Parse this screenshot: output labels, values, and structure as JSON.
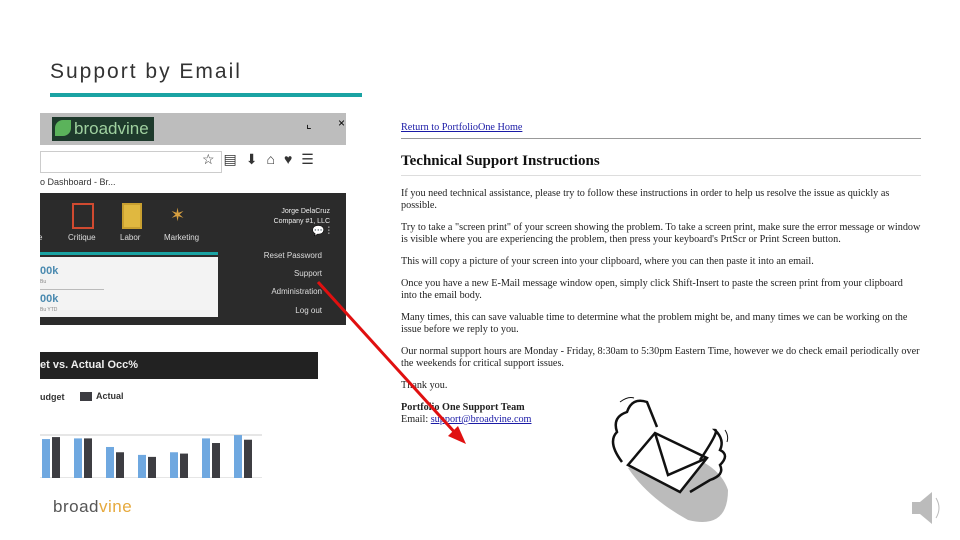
{
  "slide": {
    "title": "Support by Email",
    "logo": "broadvine",
    "logo_accent": "vine"
  },
  "screenshot": {
    "app_logo": "broadvine",
    "breadcrumb": "o Dashboard - Br...",
    "nav_items": [
      "e",
      "Critique",
      "Labor",
      "Marketing"
    ],
    "user_name": "Jorge DelaCruz",
    "company": "Company #1, LLC",
    "cards": [
      {
        "value": "00k",
        "label": "Bu"
      },
      {
        "value": "00k",
        "label": "Bu YTD"
      }
    ],
    "menu": [
      "Reset Password",
      "Support",
      "Administration",
      "Log out"
    ],
    "chart": {
      "title": "et vs. Actual Occ%",
      "legend": [
        {
          "name": "udget",
          "color": "#6fa8e0"
        },
        {
          "name": "Actual",
          "color": "#3d3d42"
        }
      ],
      "budget": [
        0.59,
        0.6,
        0.47,
        0.35,
        0.39,
        0.6,
        0.65
      ],
      "actual": [
        0.62,
        0.6,
        0.39,
        0.32,
        0.37,
        0.53,
        0.58
      ]
    }
  },
  "doc": {
    "return_link": "Return to PortfolioOne Home",
    "heading": "Technical Support Instructions",
    "paragraphs": [
      "If you need technical assistance, please try to follow these instructions in order to help us resolve the issue as quickly as possible.",
      "Try to take a \"screen print\" of your screen showing the problem. To take a screen print, make sure the error message or window is visible where you are experiencing the problem, then press your keyboard's PrtScr or Print Screen button.",
      "This will copy a picture of your screen into your clipboard, where you can then paste it into an email.",
      "Once you have a new E-Mail message window open, simply click Shift-Insert to paste the screen print from your clipboard into the email body.",
      "Many times, this can save valuable time to determine what the problem might be, and many times we can be working on the issue before we reply to you.",
      "Our normal support hours are Monday - Friday, 8:30am to 5:30pm Eastern Time, however we do check email periodically over the weekends for critical support issues.",
      "Thank you."
    ],
    "team": "Portfolio One Support Team",
    "email_label": "Email: ",
    "email": "support@broadvine.com"
  },
  "colors": {
    "accent": "#1aa3a3",
    "arrow": "#e01010"
  }
}
